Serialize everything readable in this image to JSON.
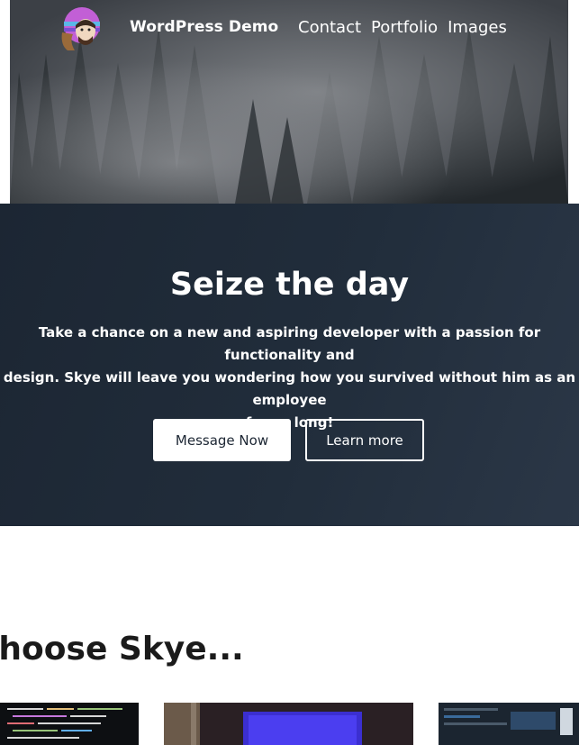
{
  "header": {
    "site_title": "WordPress Demo",
    "nav": [
      "Contact",
      "Portfolio",
      "Images"
    ]
  },
  "cta": {
    "title": "Seize the day",
    "text_line1": "Take a chance on a new and aspiring developer with a passion for functionality and",
    "text_line2": "design. Skye will leave you wondering how you survived without him as an employee",
    "text_line3": "for so long!",
    "primary_button": "Message Now",
    "secondary_button": "Learn more"
  },
  "section": {
    "title": "Choose Skye..."
  },
  "icons": {
    "logo": "avatar-logo"
  },
  "colors": {
    "cta_bg": "#212d3b",
    "button_bg": "#ffffff",
    "text_dark": "#1a1a1a"
  }
}
